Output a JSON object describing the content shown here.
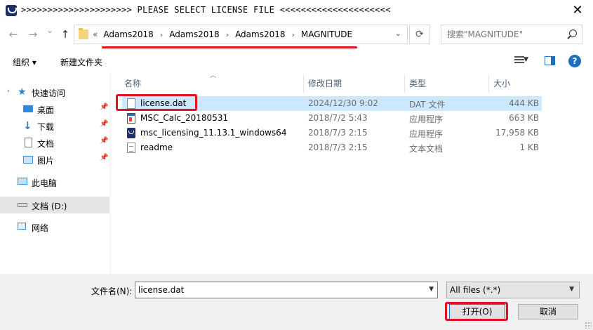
{
  "window": {
    "title": ">>>>>>>>>>>>>>>>>>>>>  PLEASE SELECT LICENSE FILE  <<<<<<<<<<<<<<<<<<<<<",
    "close_label": "✕"
  },
  "nav": {
    "back": "←",
    "forward": "→",
    "recent": "⌄",
    "up": "↑",
    "breadcrumb_prefix": "«",
    "breadcrumb": [
      "Adams2018",
      "Adams2018",
      "Adams2018",
      "MAGNITUDE"
    ],
    "separator": "›",
    "refresh": "⟳",
    "search_placeholder": "搜索\"MAGNITUDE\""
  },
  "toolbar": {
    "organize": "组织 ▾",
    "new_folder": "新建文件夹",
    "help": "?"
  },
  "sidebar": {
    "items": [
      {
        "label": "快速访问",
        "icon": "star-icon"
      },
      {
        "label": "桌面",
        "icon": "desktop-icon",
        "pinned": true
      },
      {
        "label": "下载",
        "icon": "download-icon",
        "pinned": true
      },
      {
        "label": "文档",
        "icon": "document-icon",
        "pinned": true
      },
      {
        "label": "图片",
        "icon": "pictures-icon",
        "pinned": true
      },
      {
        "label": "此电脑",
        "icon": "computer-icon"
      },
      {
        "label": "文档 (D:)",
        "icon": "drive-icon",
        "selected": true
      },
      {
        "label": "网络",
        "icon": "network-icon"
      }
    ]
  },
  "filelist": {
    "columns": [
      "名称",
      "修改日期",
      "类型",
      "大小"
    ],
    "rows": [
      {
        "name": "license.dat",
        "date": "2024/12/30 9:02",
        "type": "DAT 文件",
        "size": "444 KB",
        "icon": "dat-file-icon",
        "selected": true
      },
      {
        "name": "MSC_Calc_20180531",
        "date": "2018/7/2 5:43",
        "type": "应用程序",
        "size": "663 KB",
        "icon": "exe-file-icon"
      },
      {
        "name": "msc_licensing_11.13.1_windows64",
        "date": "2018/7/3 2:15",
        "type": "应用程序",
        "size": "17,958 KB",
        "icon": "msc-app-icon"
      },
      {
        "name": "readme",
        "date": "2018/7/3 2:15",
        "type": "文本文档",
        "size": "1 KB",
        "icon": "text-file-icon"
      }
    ]
  },
  "bottom": {
    "filename_label": "文件名(N):",
    "filename_value": "license.dat",
    "filter_value": "All files (*.*)",
    "open_label": "打开(O)",
    "cancel_label": "取消"
  },
  "colors": {
    "highlight_red": "#e0141e",
    "selection": "#cce8ff",
    "accent": "#0078d7"
  }
}
